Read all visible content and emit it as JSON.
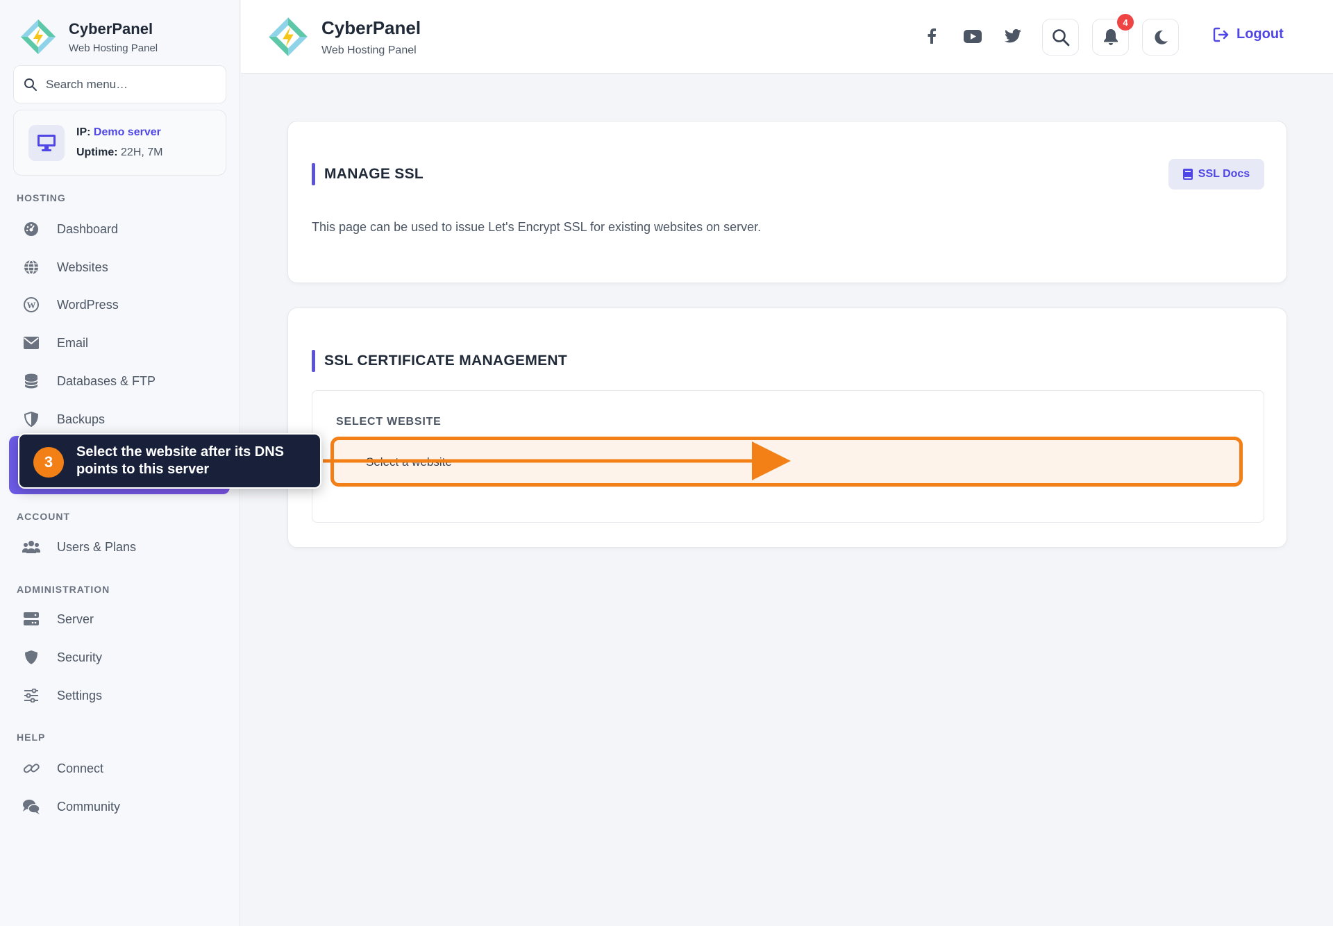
{
  "sidebar": {
    "brand_name": "CyberPanel",
    "brand_sub": "Web Hosting Panel",
    "search_placeholder": "Search menu…",
    "server": {
      "ip_label": "IP:",
      "ip_value": "Demo server",
      "uptime_label": "Uptime:",
      "uptime_value": "22H, 7M"
    },
    "sections": {
      "hosting": "HOSTING",
      "account": "ACCOUNT",
      "administration": "ADMINISTRATION",
      "help": "HELP"
    },
    "items": {
      "dashboard": "Dashboard",
      "websites": "Websites",
      "wordpress": "WordPress",
      "email": "Email",
      "databases": "Databases & FTP",
      "backups": "Backups",
      "users": "Users & Plans",
      "server": "Server",
      "security": "Security",
      "settings": "Settings",
      "connect": "Connect",
      "community": "Community"
    }
  },
  "header": {
    "brand_name": "CyberPanel",
    "brand_sub": "Web Hosting Panel",
    "notification_count": "4",
    "logout_label": "Logout"
  },
  "manage_ssl": {
    "title": "MANAGE SSL",
    "docs_label": "SSL Docs",
    "description": "This page can be used to issue Let's Encrypt SSL for existing websites on server."
  },
  "ssl_management": {
    "title": "SSL CERTIFICATE MANAGEMENT",
    "field_label": "SELECT WEBSITE",
    "select_placeholder": "Select a website"
  },
  "tooltip": {
    "step": "3",
    "text": "Select the website after its DNS points to this server"
  },
  "colors": {
    "accent": "#4f46e5",
    "highlight": "#f37f17",
    "tooltip_bg": "#18203a",
    "badge": "#ef4444"
  }
}
